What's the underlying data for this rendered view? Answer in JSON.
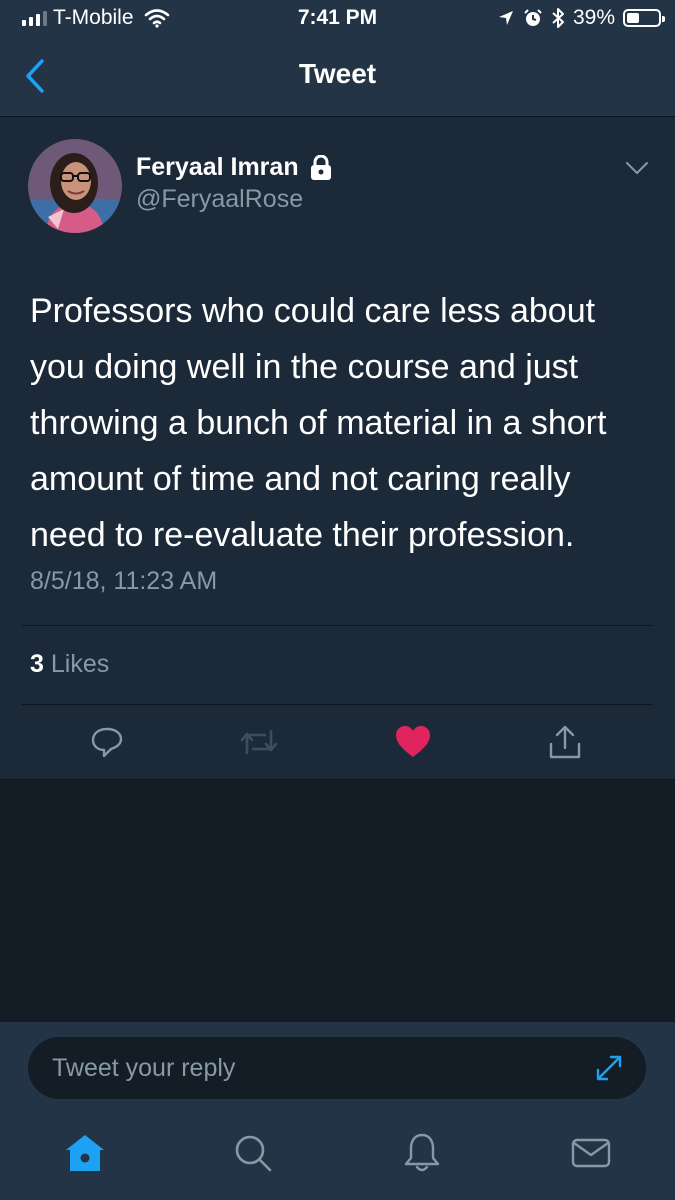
{
  "status_bar": {
    "carrier": "T-Mobile",
    "time": "7:41 PM",
    "battery": "39%",
    "battery_level": 0.39,
    "icons": [
      "signal-icon",
      "wifi-icon",
      "location-icon",
      "alarm-icon",
      "bluetooth-icon",
      "battery-icon"
    ]
  },
  "nav": {
    "title": "Tweet",
    "back_icon": "chevron-left-icon"
  },
  "tweet": {
    "author_name": "Feryaal Imran",
    "author_handle": "@FeryaalRose",
    "protected_icon": "lock-icon",
    "text": "Professors who could care less about you doing well in the course and just throwing a bunch of material in a short amount of time and not caring really need to re-evaluate their profession.",
    "timestamp": "8/5/18, 11:23 AM",
    "likes_count": "3",
    "likes_label": "Likes",
    "liked": true
  },
  "actions": [
    "reply-icon",
    "retweet-icon",
    "like-icon",
    "share-icon"
  ],
  "colors": {
    "accent": "#1da1f2",
    "like": "#e0245e",
    "background": "#141d26",
    "card": "#1c2938",
    "bar": "#243447",
    "muted": "#8899a6"
  },
  "reply_box": {
    "placeholder": "Tweet your reply"
  },
  "tabbar": {
    "items": [
      "home-icon",
      "search-icon",
      "notifications-icon",
      "messages-icon"
    ],
    "active": "home-icon"
  }
}
